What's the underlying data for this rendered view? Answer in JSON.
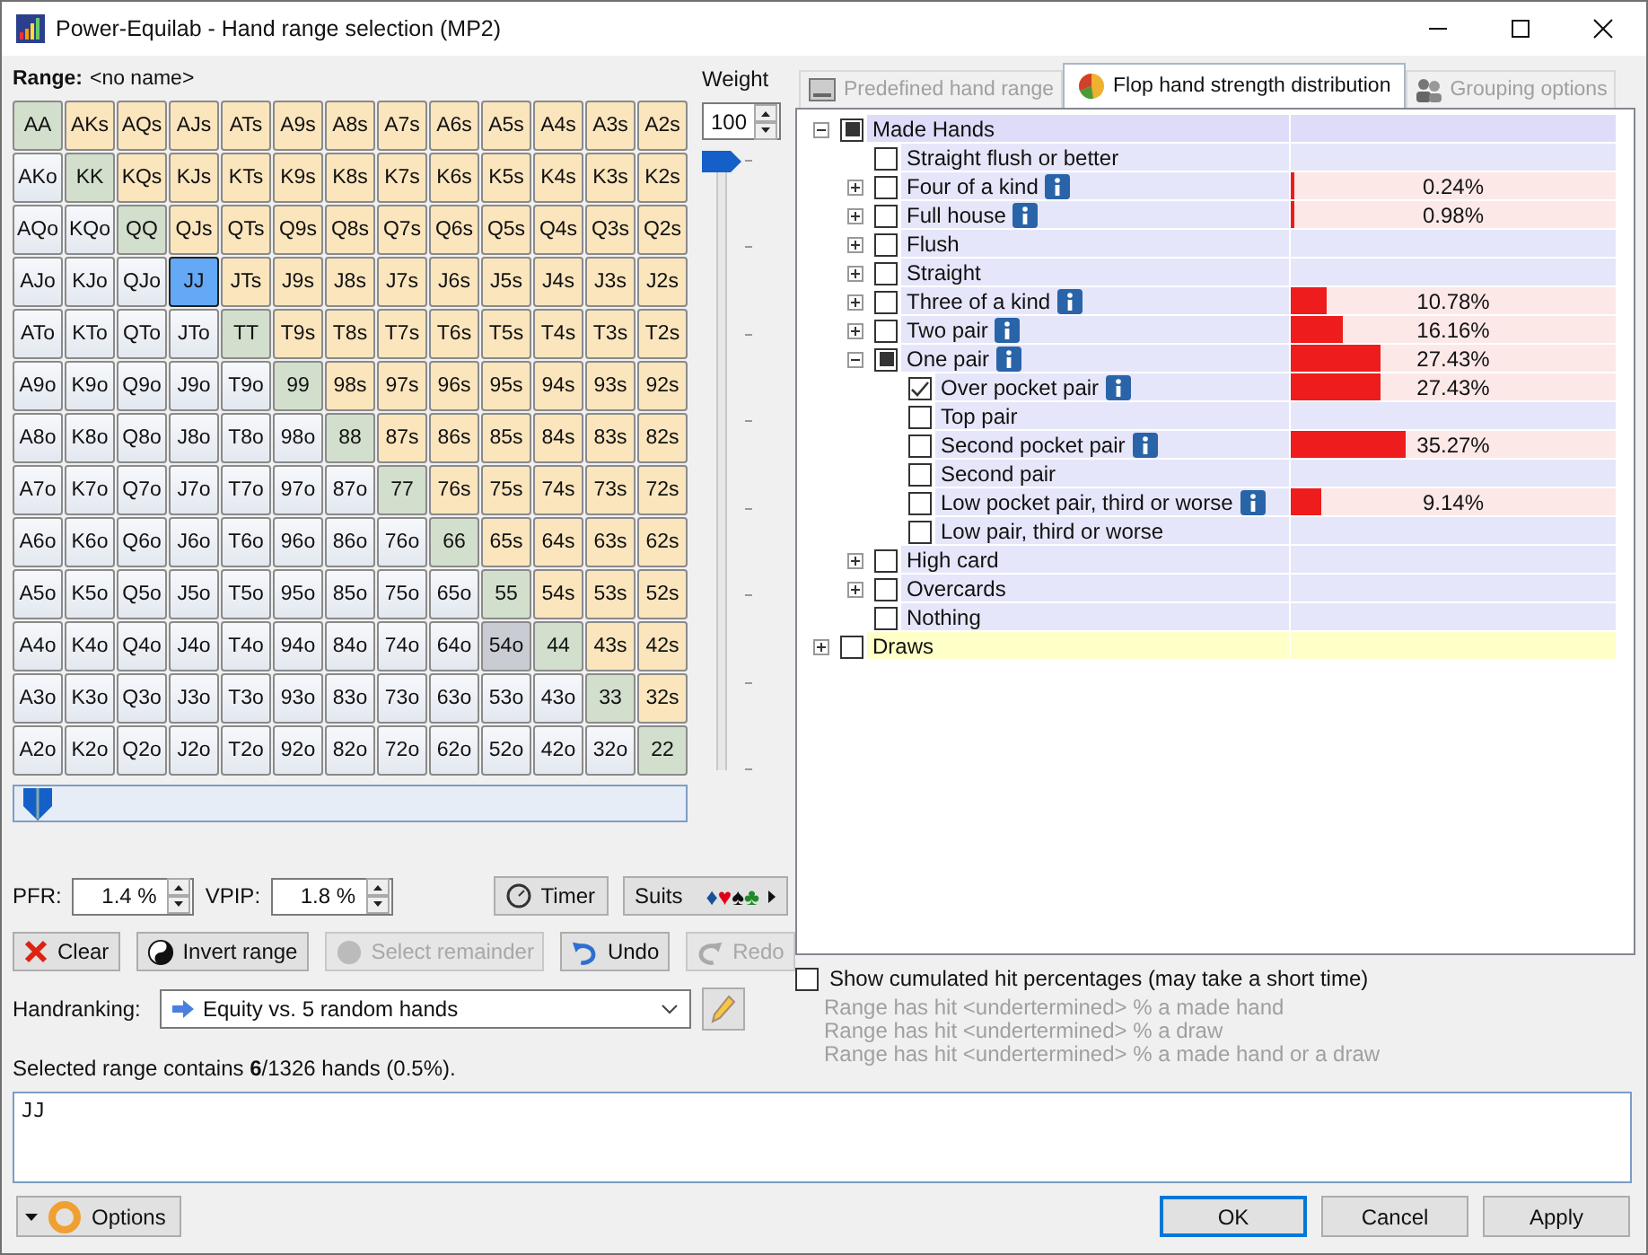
{
  "window": {
    "title": "Power-Equilab - Hand range selection (MP2)"
  },
  "range_label": "Range:",
  "range_name": "<no name>",
  "weight": {
    "label": "Weight",
    "value": "100",
    "level": 1
  },
  "grid": [
    [
      {
        "label": "AA",
        "kind": "pair",
        "selected": false
      },
      {
        "label": "AKs",
        "kind": "suited",
        "selected": false
      },
      {
        "label": "AQs",
        "kind": "suited",
        "selected": false
      },
      {
        "label": "AJs",
        "kind": "suited",
        "selected": false
      },
      {
        "label": "ATs",
        "kind": "suited",
        "selected": false
      },
      {
        "label": "A9s",
        "kind": "suited",
        "selected": false
      },
      {
        "label": "A8s",
        "kind": "suited",
        "selected": false
      },
      {
        "label": "A7s",
        "kind": "suited",
        "selected": false
      },
      {
        "label": "A6s",
        "kind": "suited",
        "selected": false
      },
      {
        "label": "A5s",
        "kind": "suited",
        "selected": false
      },
      {
        "label": "A4s",
        "kind": "suited",
        "selected": false
      },
      {
        "label": "A3s",
        "kind": "suited",
        "selected": false
      },
      {
        "label": "A2s",
        "kind": "suited",
        "selected": false
      }
    ],
    [
      {
        "label": "AKo",
        "kind": "offsuit",
        "selected": false
      },
      {
        "label": "KK",
        "kind": "pair",
        "selected": false
      },
      {
        "label": "KQs",
        "kind": "suited",
        "selected": false
      },
      {
        "label": "KJs",
        "kind": "suited",
        "selected": false
      },
      {
        "label": "KTs",
        "kind": "suited",
        "selected": false
      },
      {
        "label": "K9s",
        "kind": "suited",
        "selected": false
      },
      {
        "label": "K8s",
        "kind": "suited",
        "selected": false
      },
      {
        "label": "K7s",
        "kind": "suited",
        "selected": false
      },
      {
        "label": "K6s",
        "kind": "suited",
        "selected": false
      },
      {
        "label": "K5s",
        "kind": "suited",
        "selected": false
      },
      {
        "label": "K4s",
        "kind": "suited",
        "selected": false
      },
      {
        "label": "K3s",
        "kind": "suited",
        "selected": false
      },
      {
        "label": "K2s",
        "kind": "suited",
        "selected": false
      }
    ],
    [
      {
        "label": "AQo",
        "kind": "offsuit",
        "selected": false
      },
      {
        "label": "KQo",
        "kind": "offsuit",
        "selected": false
      },
      {
        "label": "QQ",
        "kind": "pair",
        "selected": false
      },
      {
        "label": "QJs",
        "kind": "suited",
        "selected": false
      },
      {
        "label": "QTs",
        "kind": "suited",
        "selected": false
      },
      {
        "label": "Q9s",
        "kind": "suited",
        "selected": false
      },
      {
        "label": "Q8s",
        "kind": "suited",
        "selected": false
      },
      {
        "label": "Q7s",
        "kind": "suited",
        "selected": false
      },
      {
        "label": "Q6s",
        "kind": "suited",
        "selected": false
      },
      {
        "label": "Q5s",
        "kind": "suited",
        "selected": false
      },
      {
        "label": "Q4s",
        "kind": "suited",
        "selected": false
      },
      {
        "label": "Q3s",
        "kind": "suited",
        "selected": false
      },
      {
        "label": "Q2s",
        "kind": "suited",
        "selected": false
      }
    ],
    [
      {
        "label": "AJo",
        "kind": "offsuit",
        "selected": false
      },
      {
        "label": "KJo",
        "kind": "offsuit",
        "selected": false
      },
      {
        "label": "QJo",
        "kind": "offsuit",
        "selected": false
      },
      {
        "label": "JJ",
        "kind": "pair",
        "selected": true
      },
      {
        "label": "JTs",
        "kind": "suited",
        "selected": false
      },
      {
        "label": "J9s",
        "kind": "suited",
        "selected": false
      },
      {
        "label": "J8s",
        "kind": "suited",
        "selected": false
      },
      {
        "label": "J7s",
        "kind": "suited",
        "selected": false
      },
      {
        "label": "J6s",
        "kind": "suited",
        "selected": false
      },
      {
        "label": "J5s",
        "kind": "suited",
        "selected": false
      },
      {
        "label": "J4s",
        "kind": "suited",
        "selected": false
      },
      {
        "label": "J3s",
        "kind": "suited",
        "selected": false
      },
      {
        "label": "J2s",
        "kind": "suited",
        "selected": false
      }
    ],
    [
      {
        "label": "ATo",
        "kind": "offsuit",
        "selected": false
      },
      {
        "label": "KTo",
        "kind": "offsuit",
        "selected": false
      },
      {
        "label": "QTo",
        "kind": "offsuit",
        "selected": false
      },
      {
        "label": "JTo",
        "kind": "offsuit",
        "selected": false
      },
      {
        "label": "TT",
        "kind": "pair",
        "selected": false
      },
      {
        "label": "T9s",
        "kind": "suited",
        "selected": false
      },
      {
        "label": "T8s",
        "kind": "suited",
        "selected": false
      },
      {
        "label": "T7s",
        "kind": "suited",
        "selected": false
      },
      {
        "label": "T6s",
        "kind": "suited",
        "selected": false
      },
      {
        "label": "T5s",
        "kind": "suited",
        "selected": false
      },
      {
        "label": "T4s",
        "kind": "suited",
        "selected": false
      },
      {
        "label": "T3s",
        "kind": "suited",
        "selected": false
      },
      {
        "label": "T2s",
        "kind": "suited",
        "selected": false
      }
    ],
    [
      {
        "label": "A9o",
        "kind": "offsuit",
        "selected": false
      },
      {
        "label": "K9o",
        "kind": "offsuit",
        "selected": false
      },
      {
        "label": "Q9o",
        "kind": "offsuit",
        "selected": false
      },
      {
        "label": "J9o",
        "kind": "offsuit",
        "selected": false
      },
      {
        "label": "T9o",
        "kind": "offsuit",
        "selected": false
      },
      {
        "label": "99",
        "kind": "pair",
        "selected": false
      },
      {
        "label": "98s",
        "kind": "suited",
        "selected": false
      },
      {
        "label": "97s",
        "kind": "suited",
        "selected": false
      },
      {
        "label": "96s",
        "kind": "suited",
        "selected": false
      },
      {
        "label": "95s",
        "kind": "suited",
        "selected": false
      },
      {
        "label": "94s",
        "kind": "suited",
        "selected": false
      },
      {
        "label": "93s",
        "kind": "suited",
        "selected": false
      },
      {
        "label": "92s",
        "kind": "suited",
        "selected": false
      }
    ],
    [
      {
        "label": "A8o",
        "kind": "offsuit",
        "selected": false
      },
      {
        "label": "K8o",
        "kind": "offsuit",
        "selected": false
      },
      {
        "label": "Q8o",
        "kind": "offsuit",
        "selected": false
      },
      {
        "label": "J8o",
        "kind": "offsuit",
        "selected": false
      },
      {
        "label": "T8o",
        "kind": "offsuit",
        "selected": false
      },
      {
        "label": "98o",
        "kind": "offsuit",
        "selected": false
      },
      {
        "label": "88",
        "kind": "pair",
        "selected": false
      },
      {
        "label": "87s",
        "kind": "suited",
        "selected": false
      },
      {
        "label": "86s",
        "kind": "suited",
        "selected": false
      },
      {
        "label": "85s",
        "kind": "suited",
        "selected": false
      },
      {
        "label": "84s",
        "kind": "suited",
        "selected": false
      },
      {
        "label": "83s",
        "kind": "suited",
        "selected": false
      },
      {
        "label": "82s",
        "kind": "suited",
        "selected": false
      }
    ],
    [
      {
        "label": "A7o",
        "kind": "offsuit",
        "selected": false
      },
      {
        "label": "K7o",
        "kind": "offsuit",
        "selected": false
      },
      {
        "label": "Q7o",
        "kind": "offsuit",
        "selected": false
      },
      {
        "label": "J7o",
        "kind": "offsuit",
        "selected": false
      },
      {
        "label": "T7o",
        "kind": "offsuit",
        "selected": false
      },
      {
        "label": "97o",
        "kind": "offsuit",
        "selected": false
      },
      {
        "label": "87o",
        "kind": "offsuit",
        "selected": false
      },
      {
        "label": "77",
        "kind": "pair",
        "selected": false
      },
      {
        "label": "76s",
        "kind": "suited",
        "selected": false
      },
      {
        "label": "75s",
        "kind": "suited",
        "selected": false
      },
      {
        "label": "74s",
        "kind": "suited",
        "selected": false
      },
      {
        "label": "73s",
        "kind": "suited",
        "selected": false
      },
      {
        "label": "72s",
        "kind": "suited",
        "selected": false
      }
    ],
    [
      {
        "label": "A6o",
        "kind": "offsuit",
        "selected": false
      },
      {
        "label": "K6o",
        "kind": "offsuit",
        "selected": false
      },
      {
        "label": "Q6o",
        "kind": "offsuit",
        "selected": false
      },
      {
        "label": "J6o",
        "kind": "offsuit",
        "selected": false
      },
      {
        "label": "T6o",
        "kind": "offsuit",
        "selected": false
      },
      {
        "label": "96o",
        "kind": "offsuit",
        "selected": false
      },
      {
        "label": "86o",
        "kind": "offsuit",
        "selected": false
      },
      {
        "label": "76o",
        "kind": "offsuit",
        "selected": false
      },
      {
        "label": "66",
        "kind": "pair",
        "selected": false
      },
      {
        "label": "65s",
        "kind": "suited",
        "selected": false
      },
      {
        "label": "64s",
        "kind": "suited",
        "selected": false
      },
      {
        "label": "63s",
        "kind": "suited",
        "selected": false
      },
      {
        "label": "62s",
        "kind": "suited",
        "selected": false
      }
    ],
    [
      {
        "label": "A5o",
        "kind": "offsuit",
        "selected": false
      },
      {
        "label": "K5o",
        "kind": "offsuit",
        "selected": false
      },
      {
        "label": "Q5o",
        "kind": "offsuit",
        "selected": false
      },
      {
        "label": "J5o",
        "kind": "offsuit",
        "selected": false
      },
      {
        "label": "T5o",
        "kind": "offsuit",
        "selected": false
      },
      {
        "label": "95o",
        "kind": "offsuit",
        "selected": false
      },
      {
        "label": "85o",
        "kind": "offsuit",
        "selected": false
      },
      {
        "label": "75o",
        "kind": "offsuit",
        "selected": false
      },
      {
        "label": "65o",
        "kind": "offsuit",
        "selected": false
      },
      {
        "label": "55",
        "kind": "pair",
        "selected": false
      },
      {
        "label": "54s",
        "kind": "suited",
        "selected": false
      },
      {
        "label": "53s",
        "kind": "suited",
        "selected": false
      },
      {
        "label": "52s",
        "kind": "suited",
        "selected": false
      }
    ],
    [
      {
        "label": "A4o",
        "kind": "offsuit",
        "selected": false
      },
      {
        "label": "K4o",
        "kind": "offsuit",
        "selected": false
      },
      {
        "label": "Q4o",
        "kind": "offsuit",
        "selected": false
      },
      {
        "label": "J4o",
        "kind": "offsuit",
        "selected": false
      },
      {
        "label": "T4o",
        "kind": "offsuit",
        "selected": false
      },
      {
        "label": "94o",
        "kind": "offsuit",
        "selected": false
      },
      {
        "label": "84o",
        "kind": "offsuit",
        "selected": false
      },
      {
        "label": "74o",
        "kind": "offsuit",
        "selected": false
      },
      {
        "label": "64o",
        "kind": "offsuit",
        "selected": false
      },
      {
        "label": "54o",
        "kind": "dimmed",
        "selected": false
      },
      {
        "label": "44",
        "kind": "pair",
        "selected": false
      },
      {
        "label": "43s",
        "kind": "suited",
        "selected": false
      },
      {
        "label": "42s",
        "kind": "suited",
        "selected": false
      }
    ],
    [
      {
        "label": "A3o",
        "kind": "offsuit",
        "selected": false
      },
      {
        "label": "K3o",
        "kind": "offsuit",
        "selected": false
      },
      {
        "label": "Q3o",
        "kind": "offsuit",
        "selected": false
      },
      {
        "label": "J3o",
        "kind": "offsuit",
        "selected": false
      },
      {
        "label": "T3o",
        "kind": "offsuit",
        "selected": false
      },
      {
        "label": "93o",
        "kind": "offsuit",
        "selected": false
      },
      {
        "label": "83o",
        "kind": "offsuit",
        "selected": false
      },
      {
        "label": "73o",
        "kind": "offsuit",
        "selected": false
      },
      {
        "label": "63o",
        "kind": "offsuit",
        "selected": false
      },
      {
        "label": "53o",
        "kind": "offsuit",
        "selected": false
      },
      {
        "label": "43o",
        "kind": "offsuit",
        "selected": false
      },
      {
        "label": "33",
        "kind": "pair",
        "selected": false
      },
      {
        "label": "32s",
        "kind": "suited",
        "selected": false
      }
    ],
    [
      {
        "label": "A2o",
        "kind": "offsuit",
        "selected": false
      },
      {
        "label": "K2o",
        "kind": "offsuit",
        "selected": false
      },
      {
        "label": "Q2o",
        "kind": "offsuit",
        "selected": false
      },
      {
        "label": "J2o",
        "kind": "offsuit",
        "selected": false
      },
      {
        "label": "T2o",
        "kind": "offsuit",
        "selected": false
      },
      {
        "label": "92o",
        "kind": "offsuit",
        "selected": false
      },
      {
        "label": "82o",
        "kind": "offsuit",
        "selected": false
      },
      {
        "label": "72o",
        "kind": "offsuit",
        "selected": false
      },
      {
        "label": "62o",
        "kind": "offsuit",
        "selected": false
      },
      {
        "label": "52o",
        "kind": "offsuit",
        "selected": false
      },
      {
        "label": "42o",
        "kind": "offsuit",
        "selected": false
      },
      {
        "label": "32o",
        "kind": "offsuit",
        "selected": false
      },
      {
        "label": "22",
        "kind": "pair",
        "selected": false
      }
    ]
  ],
  "range_slider": {
    "level": 0
  },
  "pfr": {
    "label": "PFR:",
    "value": "1.4 %"
  },
  "vpip": {
    "label": "VPIP:",
    "value": "1.8 %"
  },
  "timer": {
    "label": "Timer"
  },
  "suits": {
    "label": "Suits",
    "symbols": [
      {
        "symbol": "♦",
        "color": "#1a4f9c"
      },
      {
        "symbol": "♥",
        "color": "#e0001a"
      },
      {
        "symbol": "♠",
        "color": "#111111"
      },
      {
        "symbol": "♣",
        "color": "#1f8a2a"
      }
    ]
  },
  "actions": [
    {
      "label": "Clear",
      "kind": "clear",
      "disabled": false
    },
    {
      "label": "Invert range",
      "kind": "invert",
      "disabled": false
    },
    {
      "label": "Select remainder",
      "kind": "select",
      "disabled": true
    },
    {
      "label": "Undo",
      "kind": "undo",
      "disabled": false
    },
    {
      "label": "Redo",
      "kind": "redo",
      "disabled": true
    }
  ],
  "handranking": {
    "label": "Handranking:",
    "value": "Equity vs. 5 random hands"
  },
  "status": "Selected range contains **6**/1326 hands (0.5%).",
  "range_text": "JJ",
  "options_button": "Options",
  "tabs": [
    {
      "label": "Predefined hand range",
      "selected": false
    },
    {
      "label": "Flop hand strength distribution",
      "selected": true
    },
    {
      "label": "Grouping options",
      "selected": false
    }
  ],
  "tree": [
    {
      "label": "Made Hands",
      "checked": false,
      "partial": true,
      "info": false,
      "expanded": true,
      "color": "#dedcf8",
      "children": [
        {
          "label": "Straight flush or better",
          "checked": false,
          "partial": false,
          "info": false
        },
        {
          "label": "Four of a kind",
          "checked": false,
          "partial": false,
          "info": true,
          "expanded": false,
          "level": 0.0024,
          "reading": "0.24%"
        },
        {
          "label": "Full house",
          "checked": false,
          "partial": false,
          "info": true,
          "expanded": false,
          "level": 0.0098,
          "reading": "0.98%"
        },
        {
          "label": "Flush",
          "checked": false,
          "partial": false,
          "info": false,
          "expanded": false
        },
        {
          "label": "Straight",
          "checked": false,
          "partial": false,
          "info": false,
          "expanded": false
        },
        {
          "label": "Three of a kind",
          "checked": false,
          "partial": false,
          "info": true,
          "expanded": false,
          "level": 0.1078,
          "reading": "10.78%"
        },
        {
          "label": "Two pair",
          "checked": false,
          "partial": false,
          "info": true,
          "expanded": false,
          "level": 0.1616,
          "reading": "16.16%"
        },
        {
          "label": "One pair",
          "checked": false,
          "partial": true,
          "info": true,
          "expanded": true,
          "level": 0.2743,
          "reading": "27.43%",
          "children": [
            {
              "label": "Over pocket pair",
              "checked": true,
              "partial": false,
              "info": true,
              "level": 0.2743,
              "reading": "27.43%"
            },
            {
              "label": "Top pair",
              "checked": false,
              "partial": false,
              "info": false
            },
            {
              "label": "Second pocket pair",
              "checked": false,
              "partial": false,
              "info": true,
              "level": 0.3527,
              "reading": "35.27%"
            },
            {
              "label": "Second pair",
              "checked": false,
              "partial": false,
              "info": false
            },
            {
              "label": "Low pocket pair, third or worse",
              "checked": false,
              "partial": false,
              "info": true,
              "level": 0.0914,
              "reading": "9.14%"
            },
            {
              "label": "Low pair, third or worse",
              "checked": false,
              "partial": false,
              "info": false
            }
          ]
        },
        {
          "label": "High card",
          "checked": false,
          "partial": false,
          "info": false,
          "expanded": false
        },
        {
          "label": "Overcards",
          "checked": false,
          "partial": false,
          "info": false,
          "expanded": false
        },
        {
          "label": "Nothing",
          "checked": false,
          "partial": false,
          "info": false
        }
      ]
    },
    {
      "label": "Draws",
      "checked": false,
      "partial": false,
      "info": false,
      "expanded": false,
      "color": "#ffffc8"
    }
  ],
  "cumulated": {
    "label": "Show cumulated hit percentages (may take a short time)",
    "checked": false
  },
  "hit_lines": [
    "Range has hit <undertermined> % a made hand",
    "Range has hit <undertermined> % a draw",
    "Range has hit <undertermined> % a made hand or a draw"
  ],
  "buttons": [
    {
      "label": "OK",
      "default": true
    },
    {
      "label": "Cancel",
      "default": false
    },
    {
      "label": "Apply",
      "default": false
    }
  ]
}
